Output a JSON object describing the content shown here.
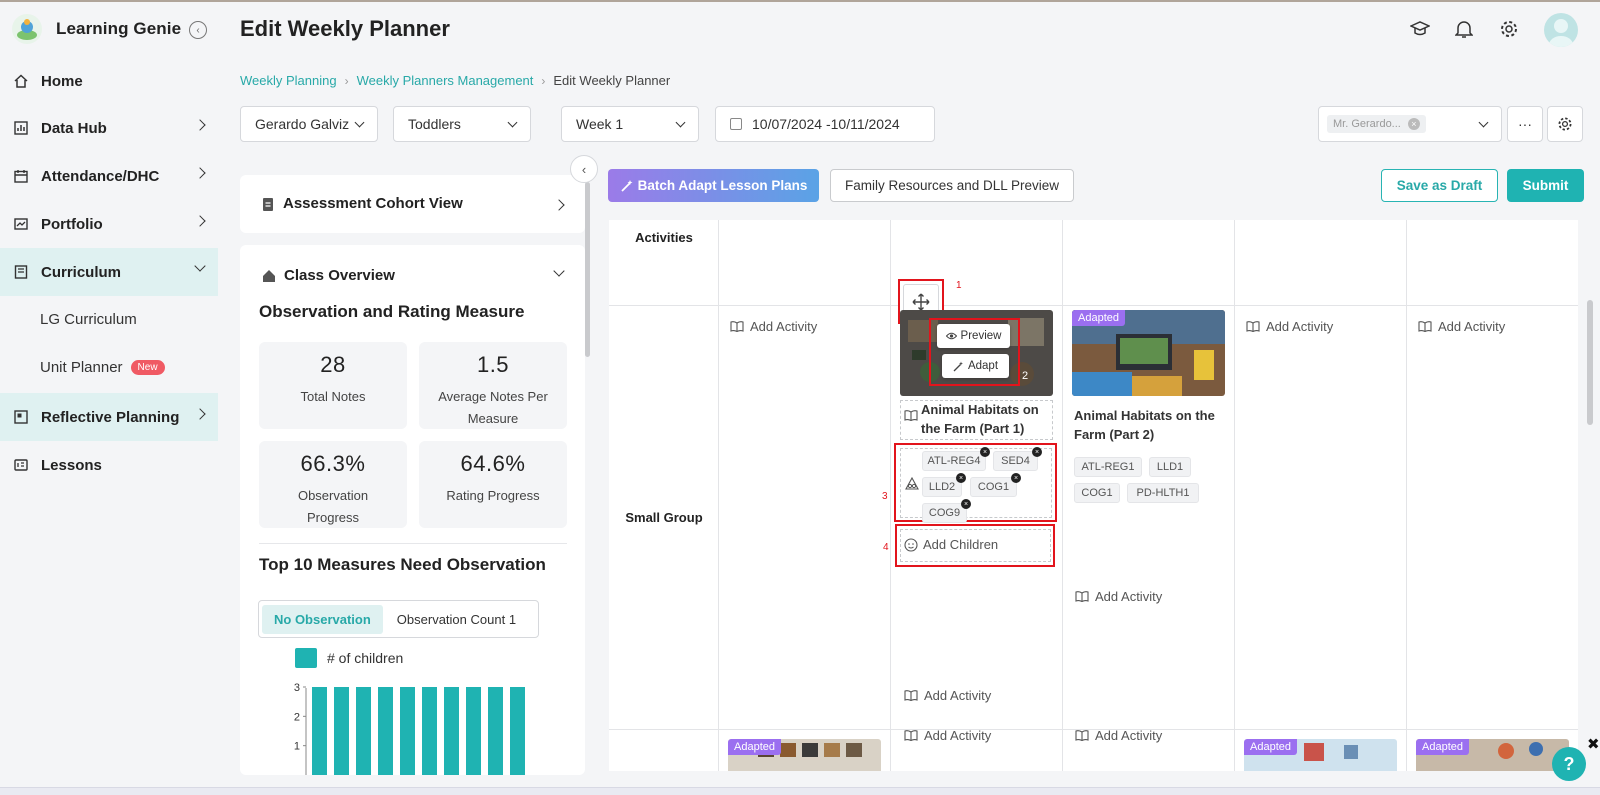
{
  "app": {
    "name": "Learning Genie"
  },
  "sidebar": {
    "items": [
      {
        "label": "Home"
      },
      {
        "label": "Data Hub"
      },
      {
        "label": "Attendance/DHC"
      },
      {
        "label": "Portfolio"
      },
      {
        "label": "Curriculum"
      },
      {
        "label": "Reflective Planning"
      },
      {
        "label": "Lessons"
      }
    ],
    "sub_items": [
      {
        "label": "LG Curriculum"
      },
      {
        "label": "Unit Planner",
        "badge": "New"
      }
    ]
  },
  "header": {
    "title": "Edit Weekly Planner"
  },
  "breadcrumb": [
    "Weekly Planning",
    "Weekly Planners Management",
    "Edit Weekly Planner"
  ],
  "filters": {
    "teacher": "Gerardo Galviz",
    "group": "Toddlers",
    "week": "Week 1",
    "date_range": "10/07/2024 -10/11/2024",
    "teacher_tag": "Mr. Gerardo...",
    "more": "···"
  },
  "left_panel": {
    "cohort_title": "Assessment Cohort View",
    "overview_title": "Class Overview",
    "measure_title": "Observation and Rating Measure",
    "stats": [
      {
        "value": "28",
        "label": "Total Notes"
      },
      {
        "value": "1.5",
        "label": "Average Notes Per Measure"
      },
      {
        "value": "66.3%",
        "label": "Observation Progress"
      },
      {
        "value": "64.6%",
        "label": "Rating Progress"
      }
    ],
    "top10_title": "Top 10 Measures Need Observation",
    "toggle": {
      "active": "No Observation",
      "inactive": "Observation Count",
      "count": "1"
    },
    "legend": "# of children"
  },
  "chart_data": {
    "type": "bar",
    "series": [
      {
        "name": "# of children",
        "values": [
          3,
          3,
          3,
          3,
          3,
          3,
          3,
          3,
          3,
          3
        ]
      }
    ],
    "yticks": [
      "3",
      "2",
      "1"
    ],
    "ylim": [
      0,
      3
    ],
    "color": "#1fb3b2"
  },
  "actions": {
    "batch_adapt": "Batch Adapt Lesson Plans",
    "family_resources": "Family Resources and DLL Preview",
    "save_draft": "Save as Draft",
    "submit": "Submit"
  },
  "planner": {
    "rows": {
      "activities": "Activities",
      "small_group": "Small Group"
    },
    "add_activity": "Add Activity",
    "add_children": "Add Children",
    "preview": "Preview",
    "adapt": "Adapt",
    "adapted": "Adapted",
    "lesson1": {
      "title": "Animal Habitats on the Farm (Part 1)",
      "tags": [
        "ATL-REG4",
        "SED4",
        "LLD2",
        "COG1",
        "COG9"
      ]
    },
    "lesson2": {
      "title": "Animal Habitats on the Farm (Part 2)",
      "tags": [
        "ATL-REG1",
        "LLD1",
        "COG1",
        "PD-HLTH1"
      ]
    },
    "markers": [
      "1",
      "2",
      "3",
      "4"
    ]
  },
  "help": "?",
  "colors": {
    "accent": "#1fb3b2",
    "highlight": "#dff1f1",
    "adapted": "#9b6ff0",
    "marker": "#e2141c"
  }
}
